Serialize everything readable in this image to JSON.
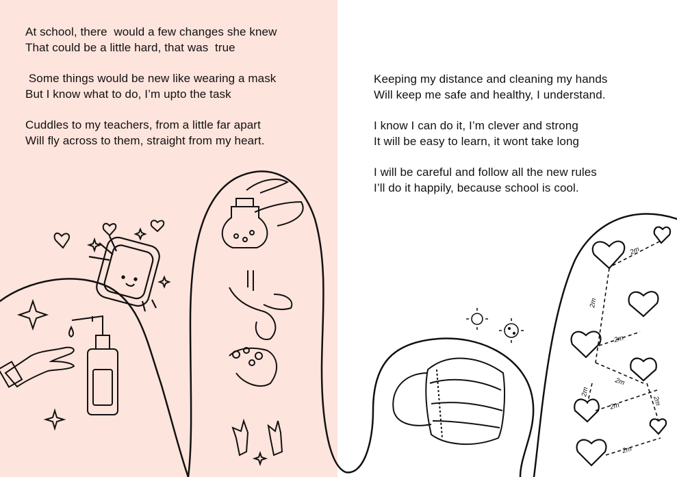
{
  "left_page": {
    "background": "#fde4dc",
    "stanzas": [
      [
        "At school, there  would a few changes she knew",
        "That could be a little hard, that was  true"
      ],
      [
        " Some things would be new like wearing a mask",
        "But I know what to do, I’m upto the task"
      ],
      [
        "Cuddles to my teachers, from a little far apart",
        "Will fly across to them, straight from my heart."
      ]
    ]
  },
  "right_page": {
    "background": "#ffffff",
    "stanzas": [
      [
        "Keeping my distance and cleaning my hands",
        "Will keep me safe and healthy, I understand."
      ],
      [
        "I know I can do it, I’m clever and strong",
        "It will be easy to learn, it wont take long"
      ],
      [
        "I will be careful and follow all the new rules",
        "I’ll do it happily, because school is cool."
      ]
    ]
  },
  "distance_labels": [
    "2m",
    "2m",
    "2m",
    "2m",
    "2m",
    "2m",
    "2m",
    "2m"
  ],
  "illustrations": [
    "soap-dispenser-icon",
    "hand-icon",
    "happy-soap-icon",
    "heart-icon",
    "sparkle-icon",
    "sanitizer-bottle-icon",
    "washing-hands-icon",
    "virus-icon",
    "face-mask-icon"
  ]
}
